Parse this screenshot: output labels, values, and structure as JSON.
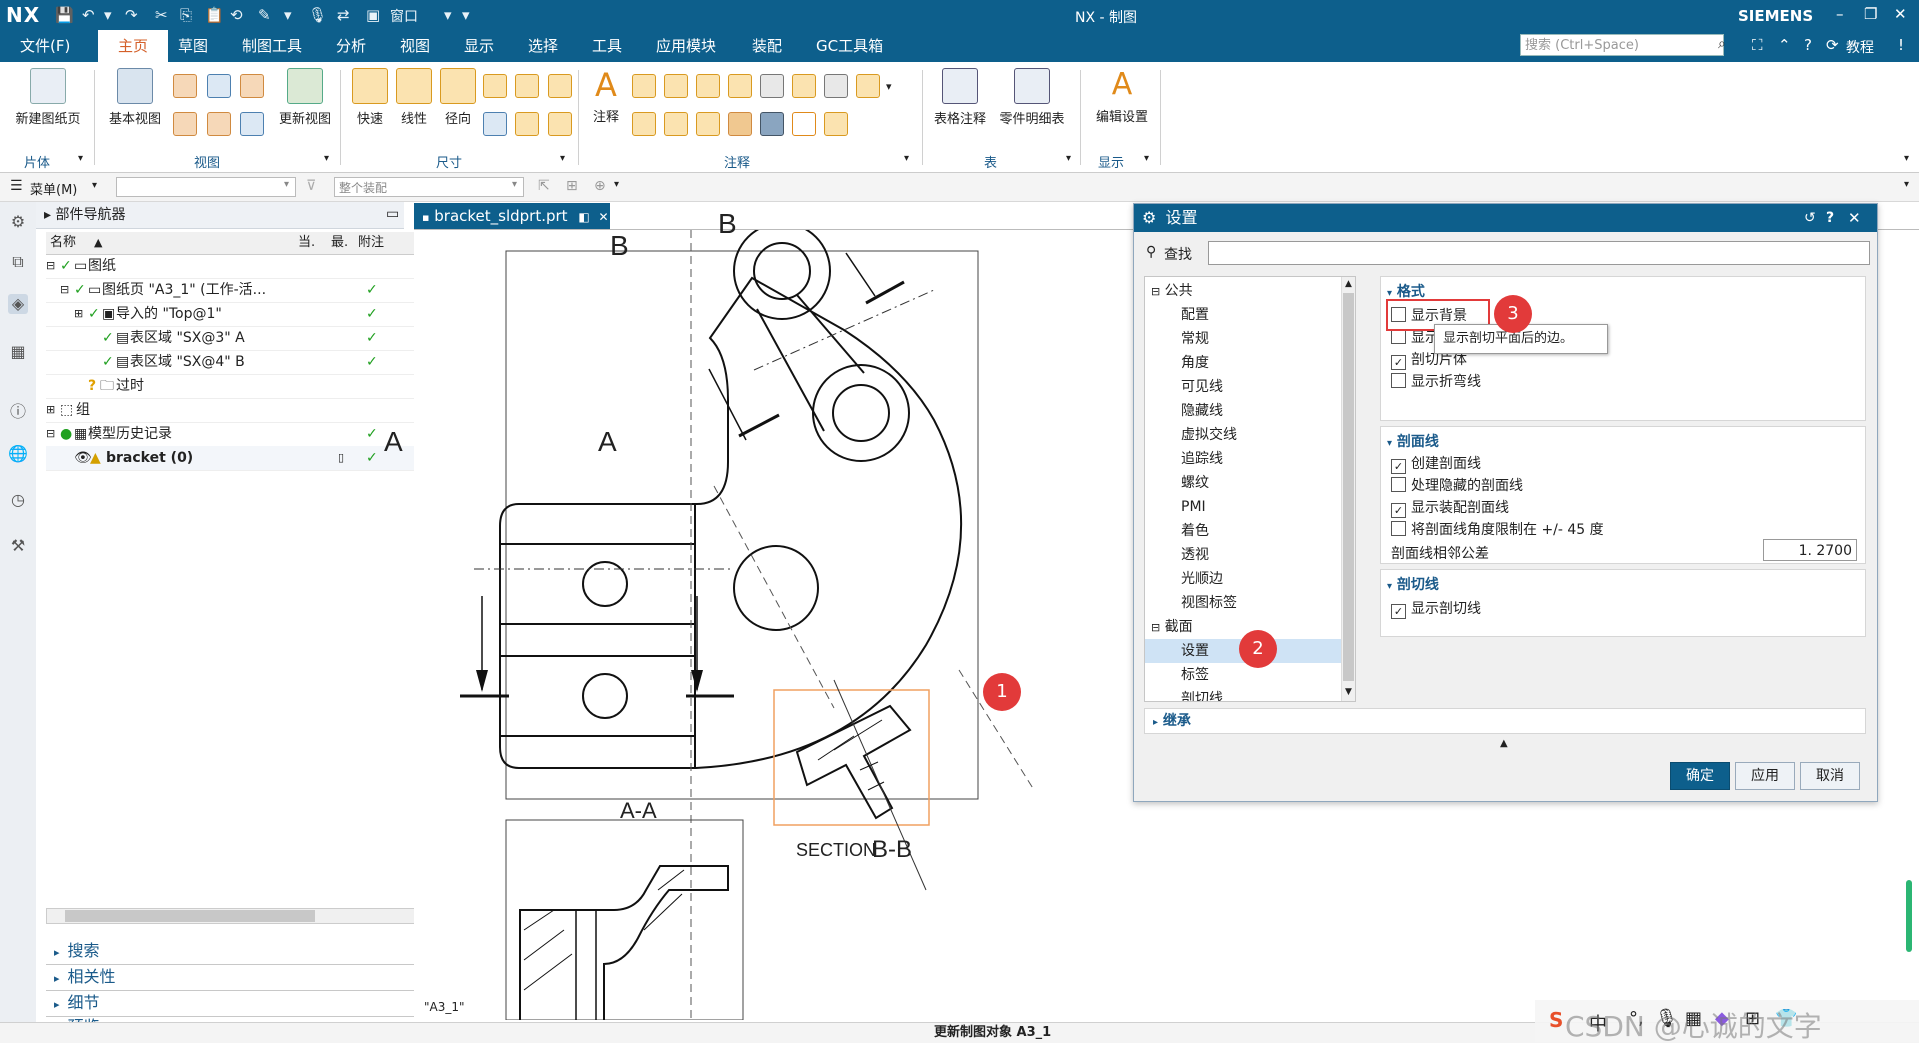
{
  "titlebar": {
    "logo": "NX",
    "window_title": "NX - 制图",
    "brand": "SIEMENS",
    "window_menu": "窗口"
  },
  "menubar": {
    "tabs": [
      "文件(F)",
      "主页",
      "草图",
      "制图工具",
      "分析",
      "视图",
      "显示",
      "选择",
      "工具",
      "应用模块",
      "装配",
      "GC工具箱"
    ],
    "search_placeholder": "搜索 (Ctrl+Space)",
    "help_label": "教程"
  },
  "ribbon": {
    "new_sheet": "新建图纸页",
    "base_view": "基本视图",
    "update_view": "更新视图",
    "quick": "快速",
    "linear": "线性",
    "radial": "径向",
    "note": "注释",
    "table_note": "表格注释",
    "parts_list": "零件明细表",
    "edit_settings": "编辑设置",
    "groups": [
      "片体",
      "视图",
      "尺寸",
      "注释",
      "表",
      "显示"
    ]
  },
  "toolbar2": {
    "menu_label": "菜单(M)",
    "combo2": "整个装配"
  },
  "navigator": {
    "title": "部件导航器",
    "columns": [
      "名称",
      "当.",
      "最.",
      "附注"
    ],
    "rows": [
      {
        "label": "图纸",
        "check": ""
      },
      {
        "label": "图纸页 \"A3_1\" (工作-活...",
        "check": "✓"
      },
      {
        "label": "导入的 \"Top@1\"",
        "check": "✓"
      },
      {
        "label": "表区域 \"SX@3\" A",
        "check": "✓"
      },
      {
        "label": "表区域 \"SX@4\" B",
        "check": "✓"
      },
      {
        "label": "过时",
        "check": ""
      },
      {
        "label": "组",
        "check": ""
      },
      {
        "label": "模型历史记录",
        "check": "✓"
      },
      {
        "label": "bracket (0)",
        "check": "✓"
      }
    ],
    "sections": [
      "搜索",
      "相关性",
      "细节",
      "预览"
    ]
  },
  "document": {
    "tab_label": "bracket_sldprt.prt",
    "sheet_label": "\"A3_1\"",
    "labels": {
      "b_top": "B",
      "b_left": "B",
      "a_left": "A",
      "a_right": "A",
      "aa": "A-A",
      "section_prefix": "SECTION",
      "section_name": "B-B"
    }
  },
  "dialog": {
    "title": "设置",
    "find_label": "查找",
    "tree": {
      "group_common": "公共",
      "common_items": [
        "配置",
        "常规",
        "角度",
        "可见线",
        "隐藏线",
        "虚拟交线",
        "追踪线",
        "螺纹",
        "PMI",
        "着色",
        "透视",
        "光顺边",
        "视图标签"
      ],
      "group_section": "截面",
      "section_items": [
        "设置",
        "标签",
        "剖切线"
      ]
    },
    "format_title": "格式",
    "format_items": [
      {
        "label": "显示背景",
        "checked": false
      },
      {
        "label": "显示前景",
        "checked": false
      },
      {
        "label": "剖切片体",
        "checked": true
      },
      {
        "label": "显示折弯线",
        "checked": false
      }
    ],
    "tooltip": "显示剖切平面后的边。",
    "hatch_title": "剖面线",
    "hatch_items": [
      {
        "label": "创建剖面线",
        "checked": true
      },
      {
        "label": "处理隐藏的剖面线",
        "checked": false
      },
      {
        "label": "显示装配剖面线",
        "checked": true
      },
      {
        "label": "将剖面线角度限制在 +/- 45 度",
        "checked": false
      }
    ],
    "hatch_tolerance_label": "剖面线相邻公差",
    "hatch_tolerance_value": "1. 2700",
    "cutline_title": "剖切线",
    "cutline_items": [
      {
        "label": "显示剖切线",
        "checked": true
      }
    ],
    "inherit_title": "继承",
    "buttons": {
      "ok": "确定",
      "apply": "应用",
      "cancel": "取消"
    }
  },
  "badges": [
    "1",
    "2",
    "3"
  ],
  "status": {
    "message": "更新制图对象 A3_1",
    "watermark": "CSDN @心诚的文字"
  },
  "colors": {
    "nx_blue": "#0d5f8c",
    "accent_orange": "#d4602a",
    "badge_red": "#e23a3a",
    "check_green": "#20a020"
  }
}
